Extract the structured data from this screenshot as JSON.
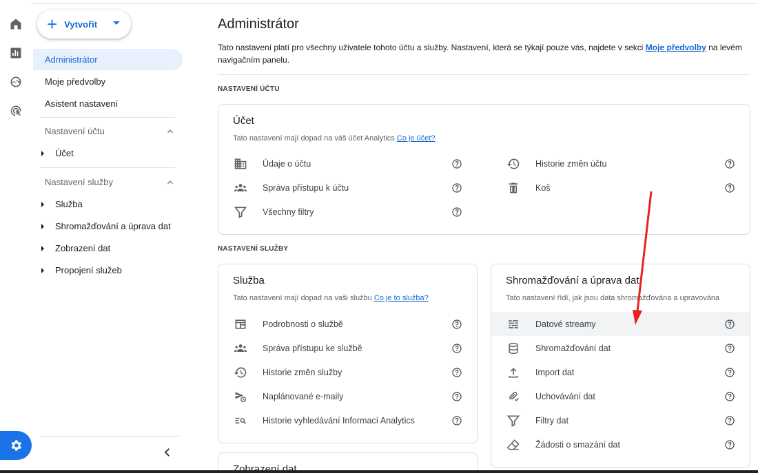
{
  "rail": {
    "items": [
      "home-icon",
      "reports-icon",
      "explore-icon",
      "advertising-icon"
    ],
    "admin_icon": "gear-icon"
  },
  "sidebar": {
    "create_label": "Vytvořit",
    "items": [
      "Administrátor",
      "Moje předvolby",
      "Asistent nastavení"
    ],
    "active_item": "Administrátor",
    "account_section": {
      "heading": "Nastavení účtu",
      "items": [
        "Účet"
      ]
    },
    "property_section": {
      "heading": "Nastavení služby",
      "items": [
        "Služba",
        "Shromažďování a úprava dat",
        "Zobrazení dat",
        "Propojení služeb"
      ]
    },
    "collapse_icon": "chevron-left-icon"
  },
  "main": {
    "title": "Administrátor",
    "intro_text": "Tato nastavení platí pro všechny uživatele tohoto účtu a služby. Nastavení, která se týkají pouze vás, najdete v sekci",
    "intro_link": "Moje předvolby",
    "intro_text_after": "na levém navigačním panelu.",
    "account_settings_label": "NASTAVENÍ ÚČTU",
    "property_settings_label": "NASTAVENÍ SLUŽBY",
    "account_card": {
      "title": "Účet",
      "desc": "Tato nastavení mají dopad na váš účet Analytics",
      "desc_link": "Co je účet?",
      "left_rows": [
        "Údaje o účtu",
        "Správa přístupu k účtu",
        "Všechny filtry"
      ],
      "right_rows": [
        "Historie změn účtu",
        "Koš"
      ]
    },
    "property_card": {
      "title": "Služba",
      "desc": "Tato nastavení mají dopad na vaši službu",
      "desc_link": "Co je to služba?",
      "rows": [
        "Podrobnosti o službě",
        "Správa přístupu ke službě",
        "Historie změn služby",
        "Naplánované e-maily",
        "Historie vyhledávání Informací Analytics"
      ]
    },
    "data_card": {
      "title": "Shromažďování a úprava dat",
      "desc": "Tato nastavení řídí, jak jsou data shromažďována a upravována",
      "rows": [
        "Datové streamy",
        "Shromažďování dat",
        "Import dat",
        "Uchovávání dat",
        "Filtry dat",
        "Žádosti o smazání dat"
      ],
      "highlighted_row": "Datové streamy"
    },
    "display_card": {
      "title": "Zobrazení dat"
    }
  },
  "colors": {
    "accent": "#1a73e8",
    "annotation_arrow": "#e8231f",
    "highlight_row": "#f1f3f4"
  }
}
